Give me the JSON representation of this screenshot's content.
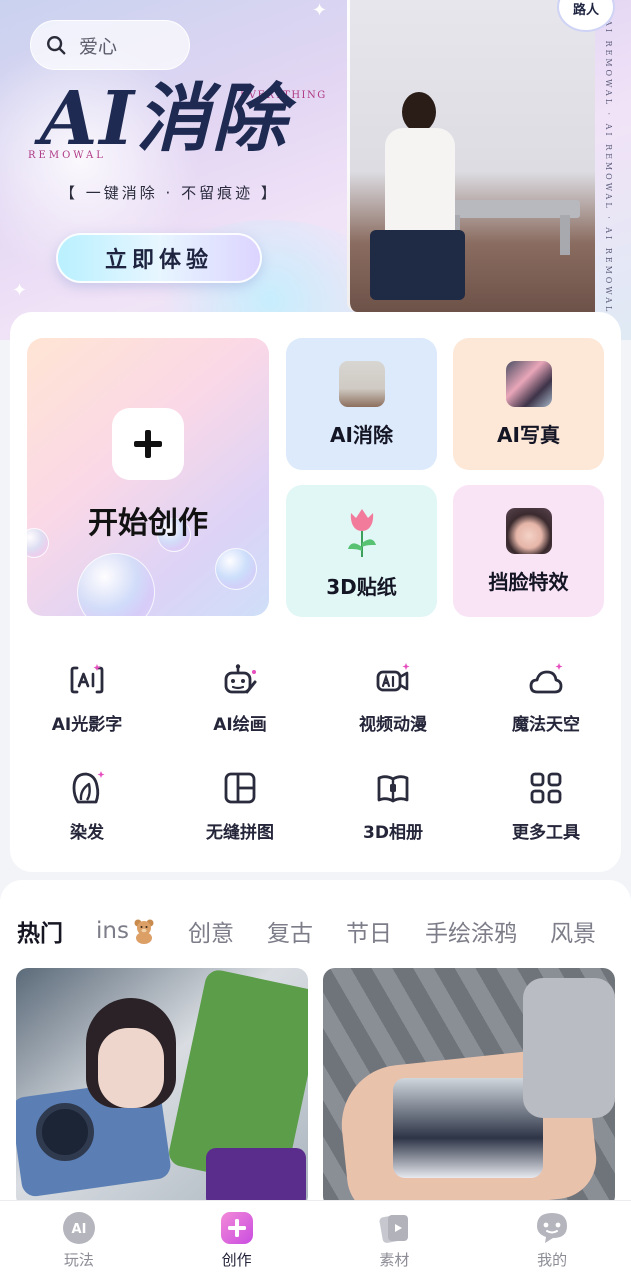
{
  "search": {
    "placeholder_text": "爱心"
  },
  "banner": {
    "title": "AI消除",
    "everything": "EVERYTHING",
    "removal": "REMOWAL",
    "subtitle": "【 一键消除 · 不留痕迹 】",
    "cta": "立即体验",
    "side_text": "AI REMOWAL · AI REMOWAL · AI REMOWAL",
    "corner_badge": "路人"
  },
  "create": {
    "start_label": "开始创作",
    "tiles": [
      {
        "label": "AI消除",
        "bg": "#dceafb"
      },
      {
        "label": "AI写真",
        "bg": "#fde8d8"
      },
      {
        "label": "3D贴纸",
        "bg": "#e1f7f5"
      },
      {
        "label": "挡脸特效",
        "bg": "#f9e4f6"
      }
    ]
  },
  "tools": [
    {
      "label": "AI光影字",
      "icon": "ai-text-icon"
    },
    {
      "label": "AI绘画",
      "icon": "robot-paint-icon"
    },
    {
      "label": "视频动漫",
      "icon": "video-ai-icon"
    },
    {
      "label": "魔法天空",
      "icon": "cloud-sparkle-icon"
    },
    {
      "label": "染发",
      "icon": "hair-dye-icon"
    },
    {
      "label": "无缝拼图",
      "icon": "collage-icon"
    },
    {
      "label": "3D相册",
      "icon": "album-icon"
    },
    {
      "label": "更多工具",
      "icon": "grid-icon"
    }
  ],
  "feed": {
    "tabs": [
      "热门",
      "ins",
      "创意",
      "复古",
      "节日",
      "手绘涂鸦",
      "风景"
    ],
    "active_tab": "热门"
  },
  "nav": {
    "items": [
      "玩法",
      "创作",
      "素材",
      "我的"
    ],
    "active": "创作",
    "play_badge": "AI"
  },
  "colors": {
    "accent_pink": "#e64fbf",
    "text_dark": "#1c1d2a"
  }
}
